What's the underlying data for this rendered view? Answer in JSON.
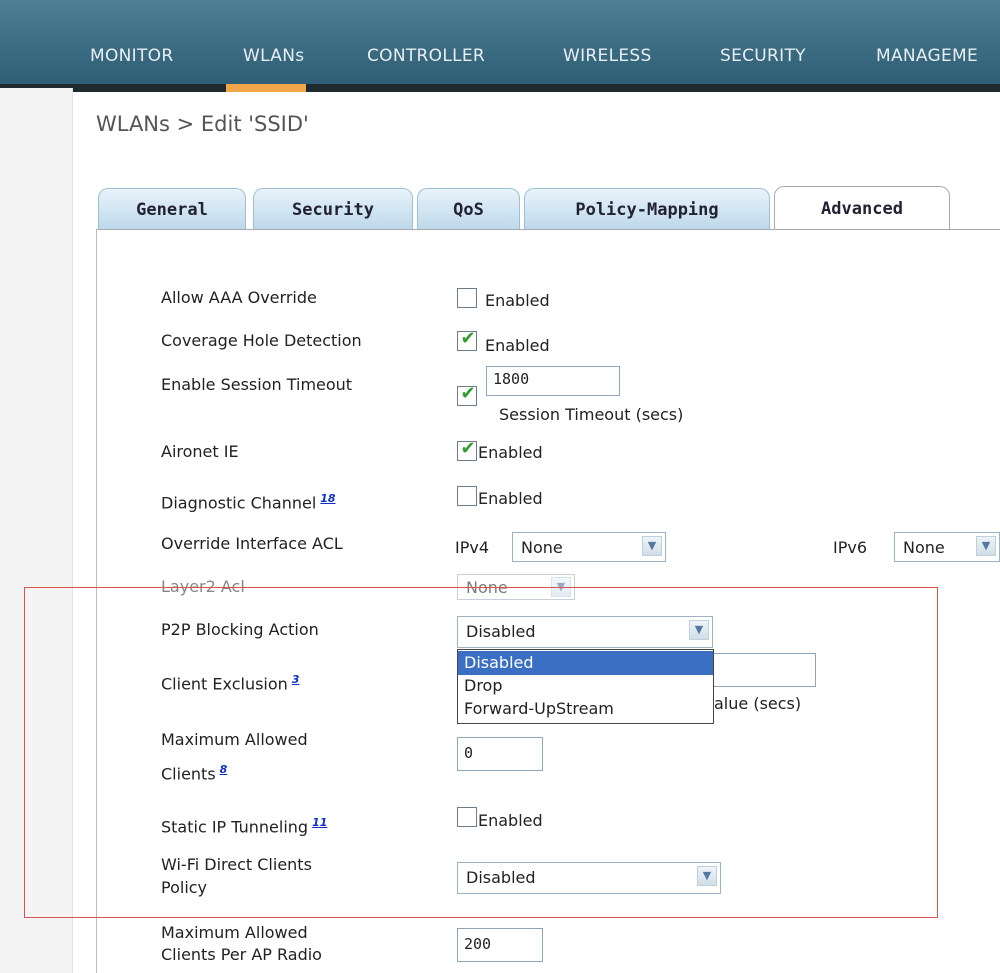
{
  "nav": {
    "items": [
      "MONITOR",
      "WLANs",
      "CONTROLLER",
      "WIRELESS",
      "SECURITY",
      "MANAGEME"
    ],
    "active": "WLANs"
  },
  "breadcrumb": "WLANs > Edit  'SSID'",
  "tabs": [
    "General",
    "Security",
    "QoS",
    "Policy-Mapping",
    "Advanced"
  ],
  "active_tab": "Advanced",
  "form": {
    "aaa_override": {
      "label": "Allow AAA Override",
      "checked": false,
      "text": "Enabled"
    },
    "coverage_hole": {
      "label": "Coverage Hole Detection",
      "checked": true,
      "text": "Enabled"
    },
    "session_timeout": {
      "label": "Enable Session Timeout",
      "checked": true,
      "value": "1800",
      "hint": "Session Timeout (secs)"
    },
    "aironet_ie": {
      "label": "Aironet IE",
      "checked": true,
      "text": "Enabled"
    },
    "diag_channel": {
      "label": "Diagnostic Channel",
      "note": "18",
      "checked": false,
      "text": "Enabled"
    },
    "override_acl": {
      "label": "Override Interface ACL",
      "ipv4_label": "IPv4",
      "ipv4_value": "None",
      "ipv6_label": "IPv6",
      "ipv6_value": "None"
    },
    "layer2_acl": {
      "label": "Layer2 Acl",
      "value": "None"
    },
    "p2p": {
      "label": "P2P Blocking Action",
      "value": "Disabled",
      "options": [
        "Disabled",
        "Drop",
        "Forward-UpStream"
      ],
      "selected_index": 0
    },
    "client_exclusion": {
      "label": "Client Exclusion",
      "note": "3",
      "hint_partial": "alue (secs)"
    },
    "max_clients": {
      "label_line1": "Maximum Allowed",
      "label_line2": "Clients",
      "note": "8",
      "value": "0"
    },
    "static_ip": {
      "label": "Static IP Tunneling",
      "note": "11",
      "checked": false,
      "text": "Enabled"
    },
    "wifi_direct": {
      "label_line1": "Wi-Fi Direct Clients",
      "label_line2": "Policy",
      "value": "Disabled"
    },
    "max_per_radio": {
      "label_line1": "Maximum Allowed",
      "label_line2": "Clients Per AP Radio",
      "value": "200"
    }
  },
  "colors": {
    "nav_bg": "#3f6f85",
    "nav_active": "#f1a64a",
    "highlight_box": "#d9534f",
    "dropdown_selected": "#3a6fc4",
    "check": "#2f9e2f"
  }
}
